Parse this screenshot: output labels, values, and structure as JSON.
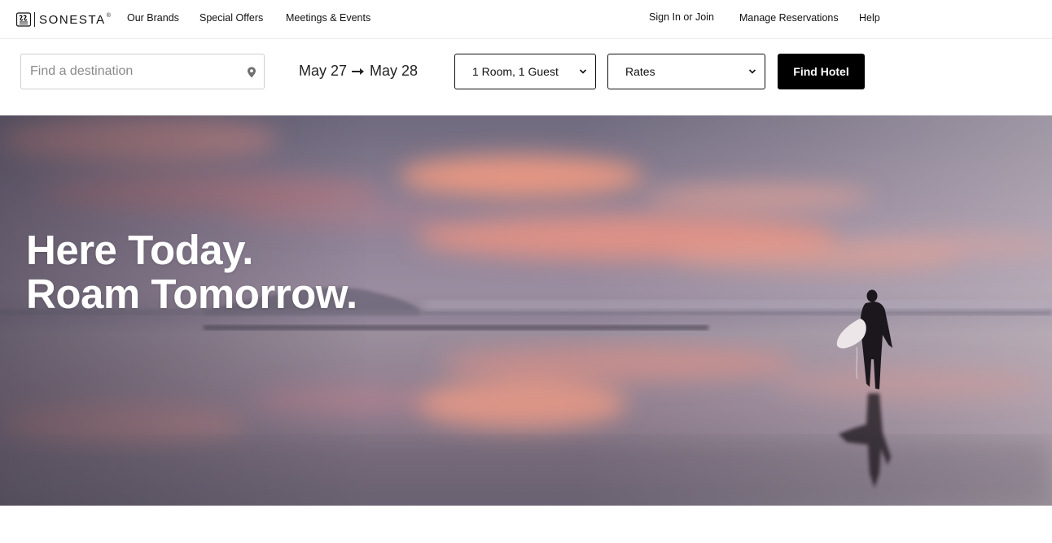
{
  "brand": {
    "name": "SONESTA",
    "tm": "®"
  },
  "nav": {
    "left": [
      {
        "label": "Our Brands"
      },
      {
        "label": "Special Offers"
      },
      {
        "label": "Meetings & Events"
      }
    ],
    "right": [
      {
        "label": "Sign In or Join"
      },
      {
        "label": "Manage Reservations"
      },
      {
        "label": "Help"
      }
    ]
  },
  "search": {
    "destination_placeholder": "Find a destination",
    "destination_value": "",
    "checkin": "May 27",
    "checkout": "May 28",
    "rooms_guests": "1 Room, 1 Guest",
    "rates": "Rates",
    "submit_label": "Find Hotel"
  },
  "hero": {
    "headline_line1": "Here Today.",
    "headline_line2": "Roam Tomorrow."
  },
  "colors": {
    "button_bg": "#000000",
    "headline": "#ffffff"
  }
}
